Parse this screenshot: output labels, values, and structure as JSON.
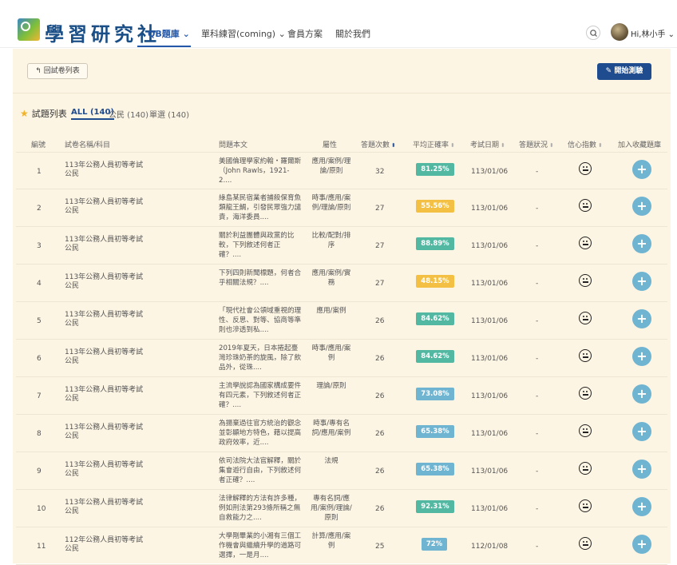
{
  "header": {
    "logo_text": "學習研究社",
    "nav": [
      {
        "label": "QB題庫 ⌄",
        "active": true
      },
      {
        "label": "單科練習(coming) ⌄",
        "active": false
      },
      {
        "label": "會員方案",
        "active": false
      },
      {
        "label": "關於我們",
        "active": false
      }
    ],
    "user_greeting": "Hi,林小手 ⌄"
  },
  "toolbar": {
    "back_label": "回試卷列表",
    "start_label": "開始測驗"
  },
  "list": {
    "title": "試題列表",
    "filters": [
      {
        "label": "ALL (140)",
        "active": true
      },
      {
        "label": "公民 (140)",
        "active": false
      },
      {
        "label": "單選 (140)",
        "active": false
      }
    ]
  },
  "table": {
    "headers": [
      "編號",
      "試卷名稱/科目",
      "問題本文",
      "屬性",
      "答題次數",
      "平均正確率",
      "考試日期",
      "答題狀況",
      "信心指數",
      "加入收藏題庫"
    ],
    "rows": [
      {
        "no": "1",
        "paper": "113年公務人員初等考試",
        "subject": "公民",
        "question": "美國倫理學家約翰・羅爾斯（John Rawls，1921-2....",
        "attr": "應用/案例/理論/原則",
        "count": "32",
        "rate": "81.25%",
        "rate_color": "#52b8a1",
        "date": "113/01/06",
        "status": "-"
      },
      {
        "no": "2",
        "paper": "113年公務人員初等考試",
        "subject": "公民",
        "question": "綠島某民宿業者捕殺保育魚類龍王鯛，引發民眾強力譴責，海洋委員....",
        "attr": "時事/應用/案例/理論/原則",
        "count": "27",
        "rate": "55.56%",
        "rate_color": "#f3c043",
        "date": "113/01/06",
        "status": "-"
      },
      {
        "no": "3",
        "paper": "113年公務人員初等考試",
        "subject": "公民",
        "question": "關於利益團體與政黨的比較，下列敘述何者正確？....",
        "attr": "比較/配對/排序",
        "count": "27",
        "rate": "88.89%",
        "rate_color": "#52b8a1",
        "date": "113/01/06",
        "status": "-"
      },
      {
        "no": "4",
        "paper": "113年公務人員初等考試",
        "subject": "公民",
        "question": "下列四則新聞標題，何者合乎相關法規？....",
        "attr": "應用/案例/實務",
        "count": "27",
        "rate": "48.15%",
        "rate_color": "#f3c043",
        "date": "113/01/06",
        "status": "-"
      },
      {
        "no": "5",
        "paper": "113年公務人員初等考試",
        "subject": "公民",
        "question": "「現代社會公領域重視的理性、反思、對等、協商等準則也滲透到私....",
        "attr": "應用/案例",
        "count": "26",
        "rate": "84.62%",
        "rate_color": "#52b8a1",
        "date": "113/01/06",
        "status": "-"
      },
      {
        "no": "6",
        "paper": "113年公務人員初等考試",
        "subject": "公民",
        "question": "2019年夏天，日本捲起臺灣珍珠奶茶的旋風，除了飲品外，從珠....",
        "attr": "時事/應用/案例",
        "count": "26",
        "rate": "84.62%",
        "rate_color": "#52b8a1",
        "date": "113/01/06",
        "status": "-"
      },
      {
        "no": "7",
        "paper": "113年公務人員初等考試",
        "subject": "公民",
        "question": "主流學說認為國家構成要件有四元素，下列敘述何者正確？....",
        "attr": "理論/原則",
        "count": "26",
        "rate": "73.08%",
        "rate_color": "#6fb4d1",
        "date": "113/01/06",
        "status": "-"
      },
      {
        "no": "8",
        "paper": "113年公務人員初等考試",
        "subject": "公民",
        "question": "為揚棄過往官方統治的觀念並彰顯地方特色，藉以提高政府效率，近....",
        "attr": "時事/專有名詞/應用/案例",
        "count": "26",
        "rate": "65.38%",
        "rate_color": "#6fb4d1",
        "date": "113/01/06",
        "status": "-"
      },
      {
        "no": "9",
        "paper": "113年公務人員初等考試",
        "subject": "公民",
        "question": "依司法院大法官解釋，關於集會遊行自由，下列敘述何者正確？....",
        "attr": "法規",
        "count": "26",
        "rate": "65.38%",
        "rate_color": "#6fb4d1",
        "date": "113/01/06",
        "status": "-"
      },
      {
        "no": "10",
        "paper": "113年公務人員初等考試",
        "subject": "公民",
        "question": "法律解釋的方法有許多種，例如刑法第293條所稱之無自救能力之....",
        "attr": "專有名詞/應用/案例/理論/原則",
        "count": "26",
        "rate": "92.31%",
        "rate_color": "#52b8a1",
        "date": "113/01/06",
        "status": "-"
      },
      {
        "no": "11",
        "paper": "112年公務人員初等考試",
        "subject": "公民",
        "question": "大學剛畢業的小湘有三個工作機會與繼續升學的道路可選擇，一是月....",
        "attr": "計算/應用/案例",
        "count": "25",
        "rate": "72%",
        "rate_color": "#6fb4d1",
        "date": "112/01/08",
        "status": "-"
      }
    ]
  }
}
